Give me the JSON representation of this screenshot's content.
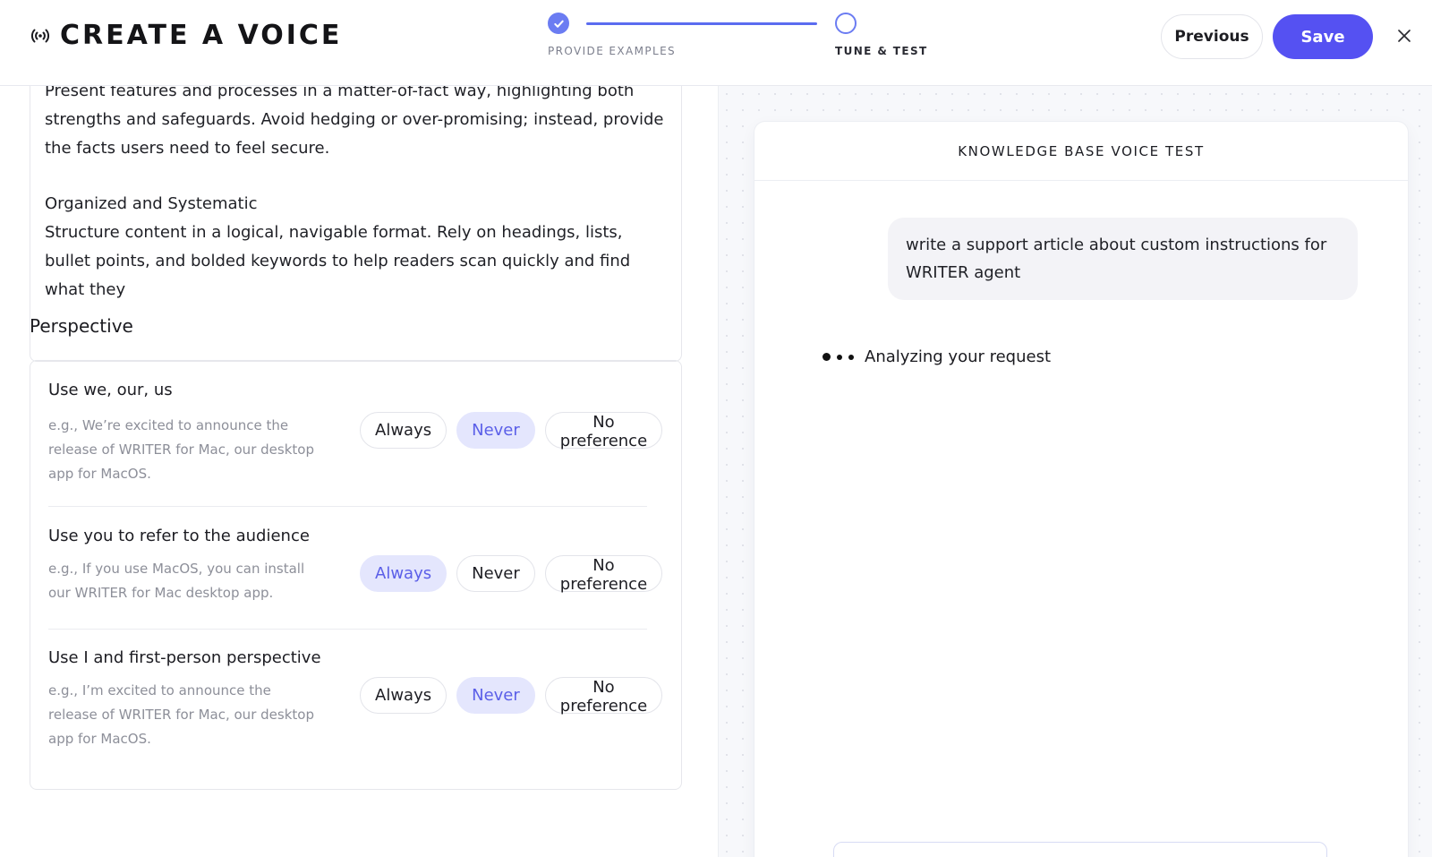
{
  "header": {
    "title": "CREATE A VOICE",
    "brand_icon": "broadcast-icon",
    "steps": [
      {
        "label": "PROVIDE EXAMPLES",
        "status": "complete"
      },
      {
        "label": "TUNE & TEST",
        "status": "current"
      }
    ],
    "previous_label": "Previous",
    "save_label": "Save",
    "close_icon": "close-icon",
    "accent_color": "#5551f2"
  },
  "guidelines": {
    "para1": "Present features and processes in a matter-of-fact way, highlighting both strengths and safeguards. Avoid hedging or over-promising; instead, provide the facts users need to feel secure.",
    "heading2": "Organized and Systematic",
    "para2": "Structure content in a logical, navigable format. Rely on headings, lists, bullet points, and bolded keywords to help readers scan quickly and find what they"
  },
  "perspective": {
    "title": "Perspective",
    "rows": [
      {
        "label": "Use we, our, us",
        "example": "e.g., We’re excited to announce the release of WRITER for Mac, our desktop app for MacOS.",
        "options": [
          "Always",
          "Never",
          "No preference"
        ],
        "selected": "Never"
      },
      {
        "label": "Use you to refer to the audience",
        "example": "e.g., If you use MacOS, you can install our WRITER for Mac desktop app.",
        "options": [
          "Always",
          "Never",
          "No preference"
        ],
        "selected": "Always"
      },
      {
        "label": "Use I and first-person perspective",
        "example": "e.g., I’m excited to announce the release of WRITER for Mac, our desktop app for MacOS.",
        "options": [
          "Always",
          "Never",
          "No preference"
        ],
        "selected": "Never"
      }
    ]
  },
  "test": {
    "title": "KNOWLEDGE BASE VOICE TEST",
    "user_message": "write a support article about custom instructions for WRITER agent",
    "status_text": "Analyzing your request"
  }
}
